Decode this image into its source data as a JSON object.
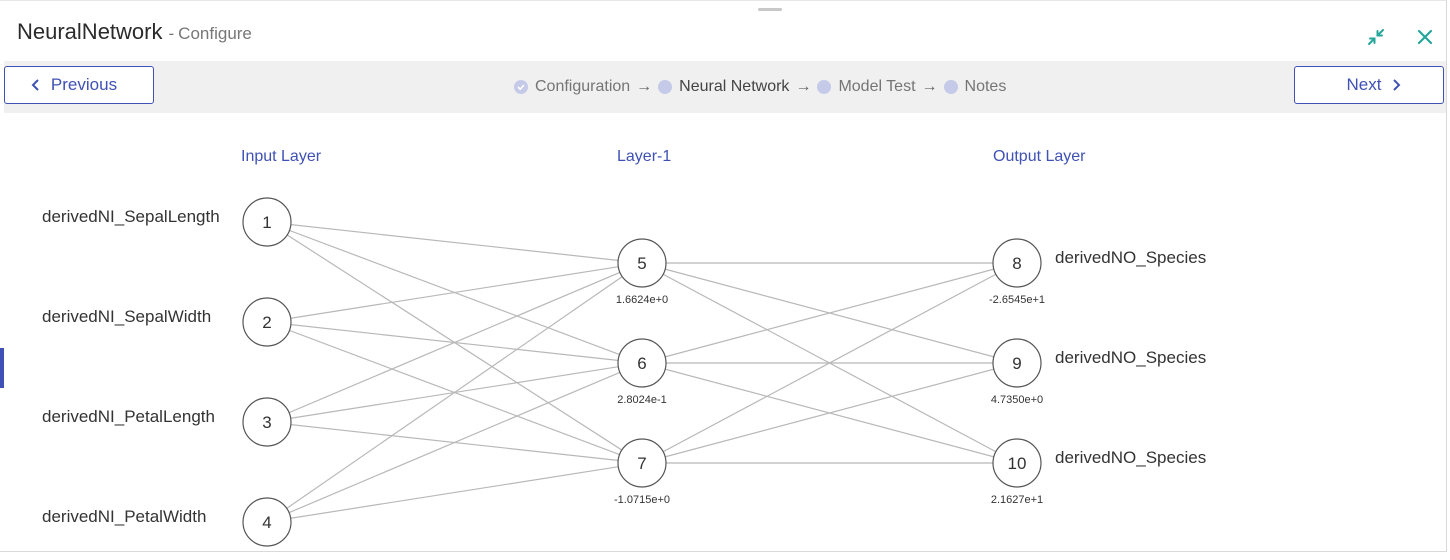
{
  "window": {
    "title": "NeuralNetwork",
    "separator": "-",
    "subtitle": "Configure"
  },
  "nav": {
    "previous_label": "Previous",
    "next_label": "Next"
  },
  "steps": [
    {
      "label": "Configuration",
      "state": "done"
    },
    {
      "label": "Neural Network",
      "state": "current"
    },
    {
      "label": "Model Test",
      "state": "todo"
    },
    {
      "label": "Notes",
      "state": "todo"
    }
  ],
  "step_arrow": "→",
  "layers": {
    "input_title": "Input Layer",
    "hidden_title": "Layer-1",
    "output_title": "Output Layer"
  },
  "input_labels": [
    "derivedNI_SepalLength",
    "derivedNI_SepalWidth",
    "derivedNI_PetalLength",
    "derivedNI_PetalWidth"
  ],
  "output_labels": [
    "derivedNO_Species",
    "derivedNO_Species",
    "derivedNO_Species"
  ],
  "nodes": [
    {
      "id": "1",
      "bias": ""
    },
    {
      "id": "2",
      "bias": ""
    },
    {
      "id": "3",
      "bias": ""
    },
    {
      "id": "4",
      "bias": ""
    },
    {
      "id": "5",
      "bias": "1.6624e+0"
    },
    {
      "id": "6",
      "bias": "2.8024e-1"
    },
    {
      "id": "7",
      "bias": "-1.0715e+0"
    },
    {
      "id": "8",
      "bias": "-2.6545e+1"
    },
    {
      "id": "9",
      "bias": "4.7350e+0"
    },
    {
      "id": "10",
      "bias": "2.1627e+1"
    }
  ],
  "colors": {
    "accent": "#3f51b5",
    "close_icon": "#26a69a",
    "edge": "#b8b8b8",
    "node_stroke": "#555555"
  },
  "icons": {
    "collapse": "collapse-arrows-icon",
    "close": "close-icon",
    "prev": "chevron-left-icon",
    "next": "chevron-right-icon",
    "done": "check-circle-icon"
  }
}
